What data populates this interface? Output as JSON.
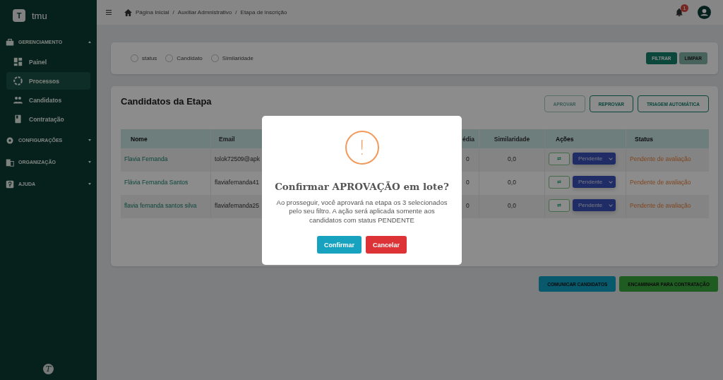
{
  "sidebar": {
    "logo_letter": "T",
    "app_name": "tmu",
    "sections": [
      {
        "label": "GERENCIAMENTO",
        "expanded": true,
        "items": [
          {
            "label": "Painel",
            "selected": false
          },
          {
            "label": "Processos",
            "selected": true
          },
          {
            "label": "Candidatos",
            "selected": false
          },
          {
            "label": "Contratação",
            "selected": false
          }
        ]
      },
      {
        "label": "CONFIGURAÇÕES",
        "expanded": false
      },
      {
        "label": "ORGANIZAÇÃO",
        "expanded": false
      },
      {
        "label": "AJUDA",
        "expanded": false
      }
    ],
    "footer_logo_letter": "T"
  },
  "topbar": {
    "breadcrumb": [
      "Página Inicial",
      "Auxiliar Admnistrativo",
      "Etapa de inscrição"
    ],
    "separator": "/",
    "notification_count": "1"
  },
  "filters": {
    "options": [
      {
        "label": "status",
        "selected": false
      },
      {
        "label": "Candidato",
        "selected": false
      },
      {
        "label": "Similaridade",
        "selected": false
      }
    ],
    "buttons": [
      {
        "label": "FILTRAR",
        "kind": "primary"
      },
      {
        "label": "LIMPAR",
        "kind": "secondary"
      }
    ]
  },
  "stage_card": {
    "title": "Candidatos da Etapa",
    "buttons": [
      {
        "label": "APROVAR",
        "disabled": true
      },
      {
        "label": "REPROVAR",
        "disabled": false
      },
      {
        "label": "TRIAGEM AUTOMÁTICA",
        "disabled": false
      }
    ],
    "table": {
      "columns": [
        "Nome",
        "Email",
        "édia",
        "Similaridade",
        "Ações",
        "Status"
      ],
      "rows": [
        {
          "name": "Flavia Fernanda",
          "email": "tolok72509@apk",
          "media": "0",
          "similarity": "0,0",
          "swap": "⇄",
          "action": "Pendente",
          "status": "Pendente de avaliação"
        },
        {
          "name": "Flávia Fernanda Santos",
          "email": "flaviafernanda41",
          "media": "0",
          "similarity": "0,0",
          "swap": "⇄",
          "action": "Pendente",
          "status": "Pendente de avaliação"
        },
        {
          "name": "flavia fernanda santos silva",
          "email": "flaviafernanda25",
          "media": "0",
          "similarity": "0,0",
          "swap": "⇄",
          "action": "Pendente",
          "status": "Pendente de avaliação"
        }
      ]
    }
  },
  "footer_buttons": [
    {
      "label": "COMUNICAR CANDIDATOS",
      "kind": "info"
    },
    {
      "label": "ENCAMINHAR PARA CONTRATAÇÃO",
      "kind": "success"
    }
  ],
  "dialog": {
    "icon": "!",
    "title": "Confirmar APROVAÇÃO em lote?",
    "message": "Ao prosseguir, você aprovará na etapa os 3 selecionados pelo seu filtro. A ação será aplicada somente aos candidatos com status PENDENTE",
    "buttons": [
      {
        "label": "Confirmar",
        "kind": "confirm"
      },
      {
        "label": "Cancelar",
        "kind": "cancel"
      }
    ]
  }
}
